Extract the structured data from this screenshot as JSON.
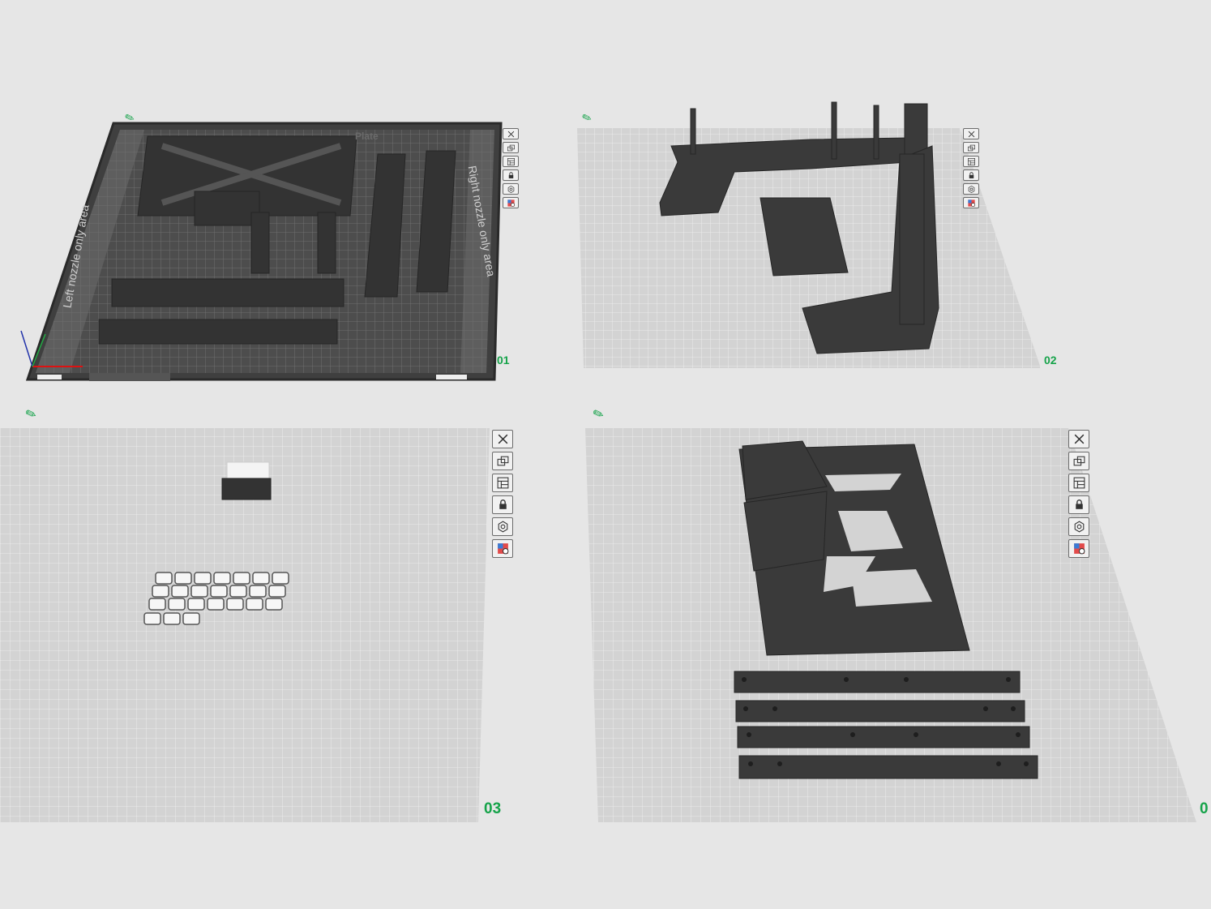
{
  "plates": [
    {
      "number": "01",
      "labels": {
        "left_zone": "Left nozzle only area",
        "right_zone": "Right nozzle only area",
        "bed_title": "Plate"
      }
    },
    {
      "number": "02"
    },
    {
      "number": "03"
    },
    {
      "number": "0"
    }
  ],
  "toolbar_icons": [
    "close-icon",
    "orient-icon",
    "arrange-icon",
    "lock-icon",
    "settings-icon",
    "plate-type-icon"
  ],
  "colors": {
    "background": "#e6e6e6",
    "plate_surface": "#d3d3d3",
    "grid_line": "#f2f2f2",
    "part": "#3b3b3b",
    "accent": "#16a34a"
  }
}
